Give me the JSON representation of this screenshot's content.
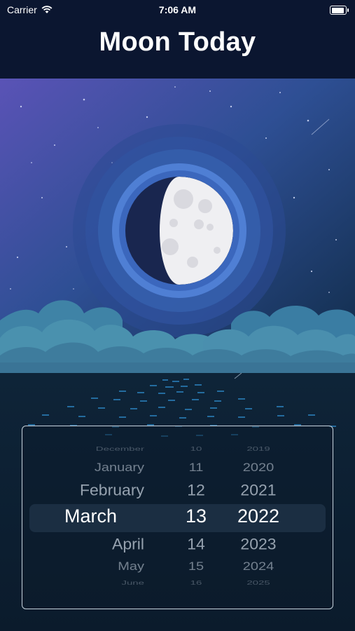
{
  "status_bar": {
    "carrier": "Carrier",
    "time": "7:06 AM",
    "battery_level": 1.0
  },
  "header": {
    "title": "Moon Today"
  },
  "moon": {
    "phase": "waxing gibbous"
  },
  "picker": {
    "months": [
      "December",
      "January",
      "February",
      "March",
      "April",
      "May",
      "June"
    ],
    "days": [
      "10",
      "11",
      "12",
      "13",
      "14",
      "15",
      "16"
    ],
    "years": [
      "2019",
      "2020",
      "2021",
      "2022",
      "2023",
      "2024",
      "2025"
    ],
    "selected": {
      "month": "March",
      "day": "13",
      "year": "2022"
    }
  },
  "colors": {
    "header_bg": "#0b1630",
    "sky_top": "#5a53b6",
    "sky_bottom": "#0e2a44",
    "ring": "#4f7fd4",
    "moon_lit": "#efeff2",
    "moon_dark": "#19264f",
    "water": "#0e2438",
    "sparkle": "#2f8fd1"
  }
}
